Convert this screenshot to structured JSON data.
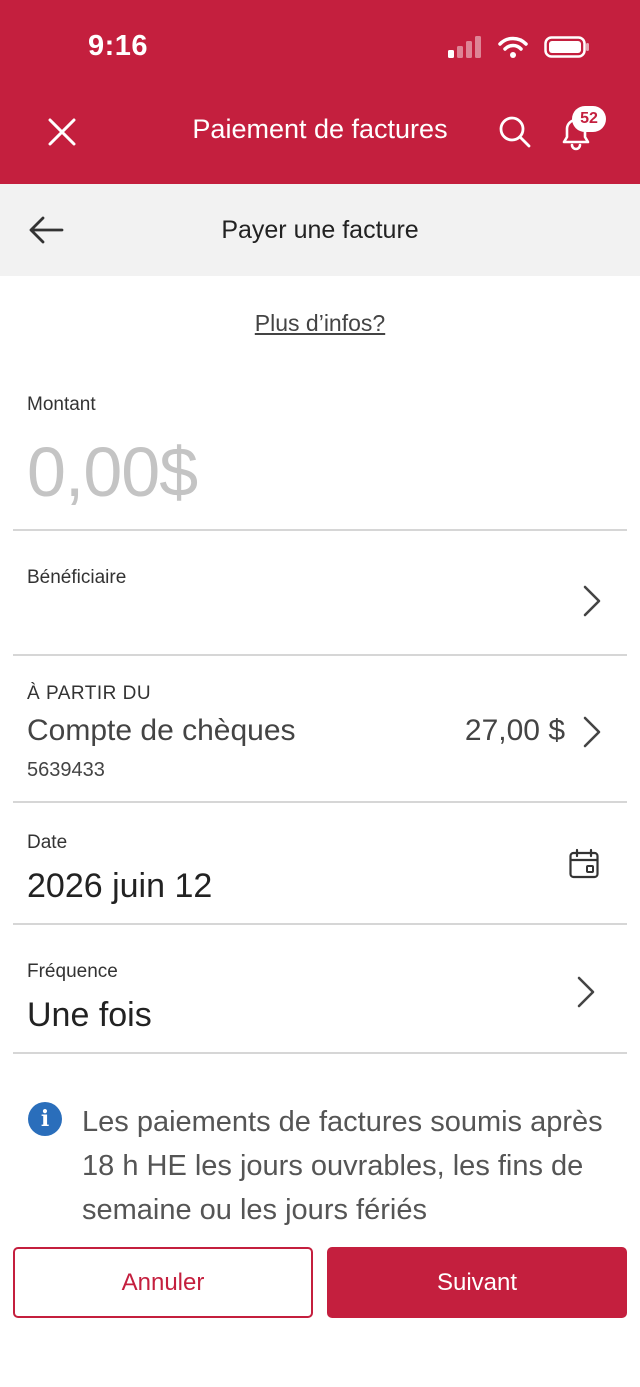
{
  "status_bar": {
    "time": "9:16"
  },
  "header": {
    "title": "Paiement de factures",
    "notification_count": "52"
  },
  "sub_header": {
    "title": "Payer une facture"
  },
  "more_info_link": "Plus d’infos?",
  "amount": {
    "label": "Montant",
    "value": "0,00$"
  },
  "payee": {
    "label": "Bénéficiaire"
  },
  "from_account": {
    "label": "À PARTIR DU",
    "name": "Compte de chèques",
    "balance": "27,00 $",
    "number": "5639433"
  },
  "date": {
    "label": "Date",
    "value": "2026 juin 12"
  },
  "frequency": {
    "label": "Fréquence",
    "value": "Une fois"
  },
  "info_message": "Les paiements de factures soumis après 18 h HE les jours ouvrables, les fins de semaine ou les jours fériés",
  "buttons": {
    "cancel": "Annuler",
    "next": "Suivant"
  },
  "colors": {
    "brand_red": "#c41f3e",
    "info_blue": "#2a6ebb",
    "placeholder_gray": "#c4c4c4"
  },
  "icons": [
    "signal-icon",
    "wifi-icon",
    "battery-icon",
    "close-icon",
    "search-icon",
    "bell-icon",
    "back-arrow-icon",
    "chevron-right-icon",
    "calendar-icon",
    "info-icon"
  ]
}
